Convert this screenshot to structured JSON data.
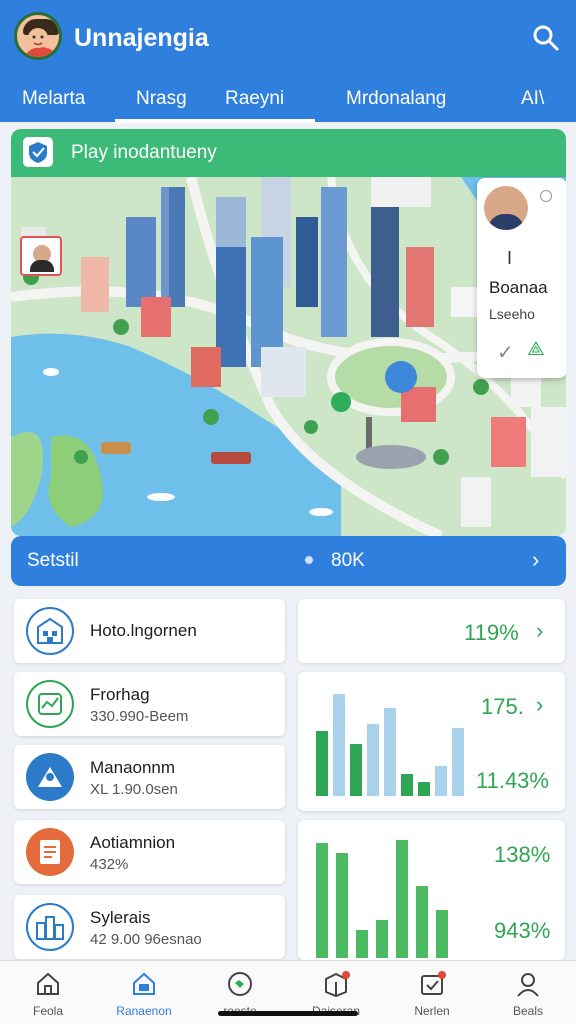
{
  "header": {
    "title": "Unnajengia",
    "tabs": [
      {
        "label": "Melarta"
      },
      {
        "label": "Nrasg"
      },
      {
        "label": "Raeyni"
      },
      {
        "label": "Mrdonalang"
      },
      {
        "label": "AI\\"
      }
    ],
    "active_tab": "Nrasg",
    "colors": {
      "primary": "#2f7fde",
      "accent": "#3cbb78"
    }
  },
  "map_card": {
    "banner_label": "Play inodantueny",
    "profile": {
      "name": "Boanaa",
      "sub": "Lseeho",
      "cursor_mark": "I"
    }
  },
  "stat_bar": {
    "label": "Setstil",
    "value": "80K"
  },
  "list": [
    {
      "title": "Hoto.lngornen",
      "sub": "",
      "icon": "building-icon",
      "color": "#2b7bc9"
    },
    {
      "title": "Frorhag",
      "sub": "330.990-Beem",
      "icon": "chart-icon",
      "color": "#2fa653"
    },
    {
      "title": "Manaonnm",
      "sub": "XL 1.90.0sen",
      "icon": "profile-card-icon",
      "color": "#2b7bc9"
    },
    {
      "title": "Aotiamnion",
      "sub": "432%",
      "icon": "clipboard-icon",
      "color": "#e36b3c"
    },
    {
      "title": "Sylerais",
      "sub": "42 9.00 96esnao",
      "icon": "city-icon",
      "color": "#2b7bc9"
    }
  ],
  "stat_cards": [
    {
      "value": "119%"
    },
    {
      "value": "175.",
      "secondary": "11.43%",
      "bars": [
        65,
        102,
        52,
        72,
        88,
        22,
        14,
        30,
        68
      ]
    },
    {
      "value": "138%",
      "secondary": "943%",
      "bars": [
        115,
        105,
        28,
        38,
        118,
        72,
        48
      ]
    }
  ],
  "bottom_nav": [
    {
      "label": "Feola",
      "icon": "home-icon"
    },
    {
      "label": "Ranaenon",
      "icon": "map-icon",
      "active": true
    },
    {
      "label": "reeste",
      "icon": "globe-icon"
    },
    {
      "label": "Daiseran",
      "icon": "box-icon",
      "badge": true
    },
    {
      "label": "Nerlen",
      "icon": "check-icon",
      "badge": true
    },
    {
      "label": "Beals",
      "icon": "user-icon"
    }
  ]
}
